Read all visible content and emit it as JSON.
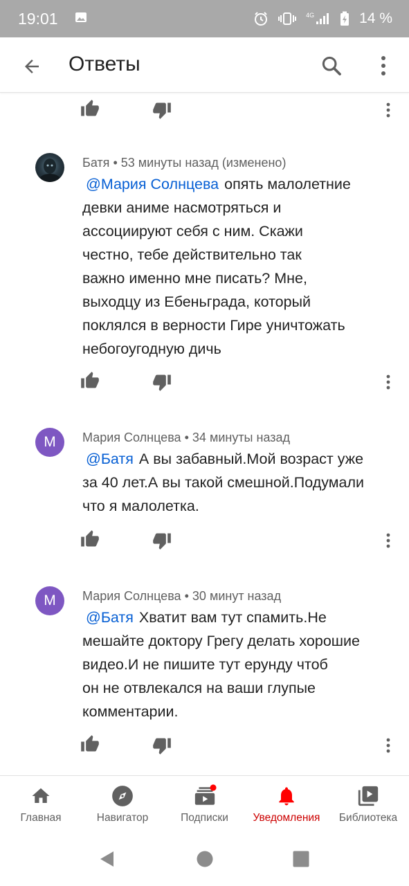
{
  "status_bar": {
    "time": "19:01",
    "network": "4G",
    "battery": "14 %",
    "icons": [
      "image-icon",
      "alarm-icon",
      "vibrate-icon",
      "signal-icon",
      "battery-icon"
    ]
  },
  "app_bar": {
    "title": "Ответы",
    "icons": [
      "back-arrow-icon",
      "search-icon",
      "more-vert-icon"
    ]
  },
  "comments": [
    {
      "author": "Батя",
      "time": "53 минуты назад (изменено)",
      "avatar": "photo",
      "mention": "@Мария Солнцева",
      "lines": [
        "опять малолетние",
        "девки аниме насмотряться и",
        "ассоциируют себя с ним. Скажи",
        "честно, тебе действительно так",
        "важно именно мне писать? Мне,",
        "выходцу из Ебеньграда, который",
        "поклялся в верности Гире уничтожать",
        "небогоугодную дичь"
      ]
    },
    {
      "author": "Мария Солнцева",
      "time": "34 минуты назад",
      "avatar_letter": "M",
      "mention": "@Батя",
      "lines": [
        "А вы забавный.Мой возраст уже",
        "за 40 лет.А вы такой смешной.Подумали",
        "что я малолетка."
      ]
    },
    {
      "author": "Мария Солнцева",
      "time": "30 минут назад",
      "avatar_letter": "M",
      "mention": "@Батя",
      "lines": [
        "Хватит вам тут спамить.Не",
        "мешайте доктору Грегу делать хорошие",
        "видео.И не пишите тут ерунду чтоб",
        "он не отвлекался на ваши глупые",
        "комментарии."
      ]
    }
  ],
  "meta_separator": "•",
  "bottom_nav": {
    "items": [
      {
        "label": "Главная",
        "icon": "home-icon"
      },
      {
        "label": "Навигатор",
        "icon": "compass-icon"
      },
      {
        "label": "Подписки",
        "icon": "subscriptions-icon"
      },
      {
        "label": "Уведомления",
        "icon": "bell-icon"
      },
      {
        "label": "Библиотека",
        "icon": "library-icon"
      }
    ],
    "active_index": 3
  },
  "colors": {
    "accent_red": "#cc0000",
    "mention_blue": "#065fd4",
    "avatar_purple": "#7e57c2",
    "status_bar_gray": "#a9a9a9"
  }
}
